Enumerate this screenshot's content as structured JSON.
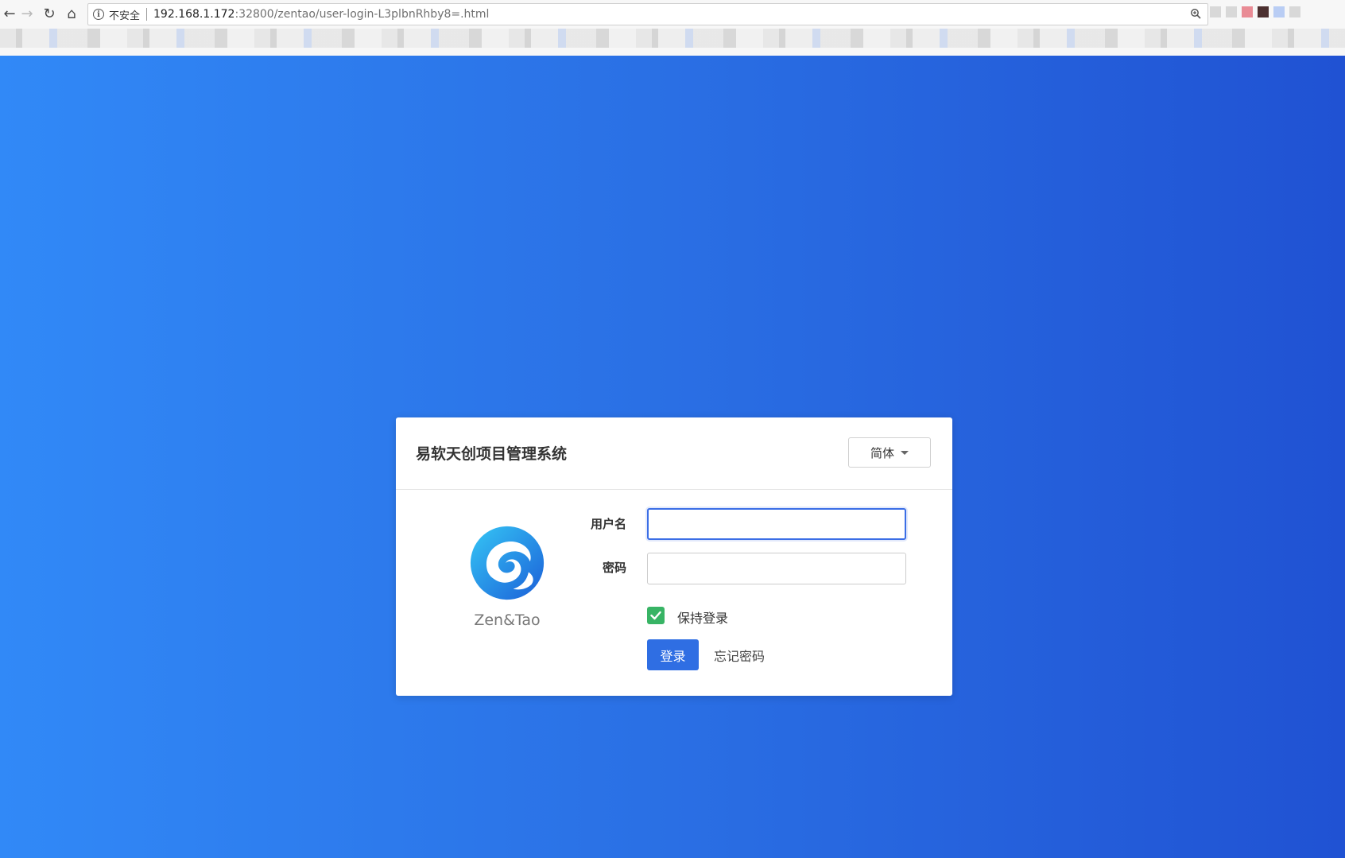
{
  "browser": {
    "nav_back": "←",
    "nav_forward": "→",
    "nav_reload": "↻",
    "nav_home": "⌂",
    "security_label": "不安全",
    "url_host": "192.168.1.172",
    "url_rest": ":32800/zentao/user-login-L3plbnRhby8=.html"
  },
  "login": {
    "title": "易软天创项目管理系统",
    "language": "简体",
    "logo_text": "Zen&Tao",
    "username_label": "用户名",
    "username_value": "",
    "password_label": "密码",
    "password_value": "",
    "remember_label": "保持登录",
    "remember_checked": true,
    "submit_label": "登录",
    "forgot_label": "忘记密码"
  },
  "colors": {
    "background_start": "#3189f7",
    "background_end": "#2052d3",
    "primary_button": "#2f6ee3",
    "checkbox": "#38b465"
  },
  "icons": {
    "info": "info-icon",
    "zoom": "zoom-icon",
    "caret": "caret-down-icon",
    "check": "check-icon",
    "logo": "zentao-logo-icon"
  }
}
